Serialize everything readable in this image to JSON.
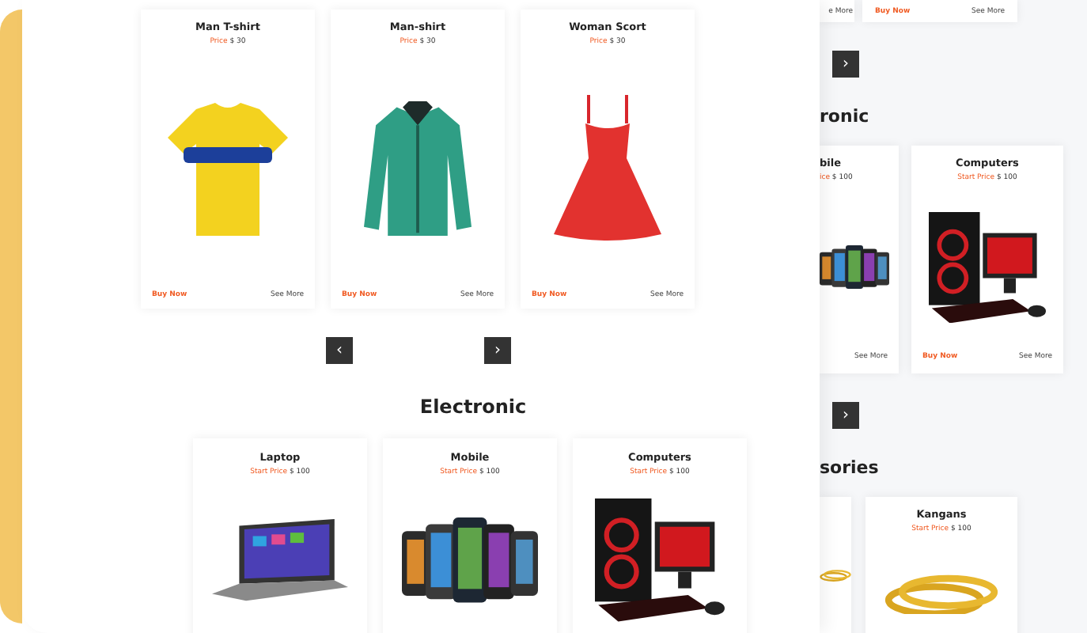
{
  "front": {
    "products": [
      {
        "name": "Man T-shirt",
        "price_label": "Price",
        "price": "$ 30",
        "kind": "tshirt",
        "buy": "Buy Now",
        "more": "See More"
      },
      {
        "name": "Man-shirt",
        "price_label": "Price",
        "price": "$ 30",
        "kind": "shirt",
        "buy": "Buy Now",
        "more": "See More"
      },
      {
        "name": "Woman Scort",
        "price_label": "Price",
        "price": "$ 30",
        "kind": "dress",
        "buy": "Buy Now",
        "more": "See More"
      }
    ],
    "prev": "‹",
    "next": "›",
    "section": {
      "title": "Electronic",
      "products": [
        {
          "name": "Laptop",
          "price_label": "Start Price",
          "price": "$ 100",
          "kind": "laptop"
        },
        {
          "name": "Mobile",
          "price_label": "Start Price",
          "price": "$ 100",
          "kind": "phones"
        },
        {
          "name": "Computers",
          "price_label": "Start Price",
          "price": "$ 100",
          "kind": "computer"
        }
      ]
    }
  },
  "back": {
    "top_cards": [
      {
        "more": "e More"
      },
      {
        "buy": "Buy Now",
        "more": "See More"
      }
    ],
    "next_1": "›",
    "title_1": "ronic",
    "cards_1": [
      {
        "name": "bile",
        "price_label": "ice",
        "price": "$ 100",
        "kind": "phones",
        "more": "See More"
      },
      {
        "name": "Computers",
        "price_label": "Start Price",
        "price": "$ 100",
        "kind": "computer",
        "buy": "Buy Now",
        "more": "See More"
      }
    ],
    "next_2": "›",
    "title_2": "sories",
    "cards_2": [
      {
        "kind": "bangles"
      },
      {
        "name": "Kangans",
        "price_label": "Start Price",
        "price": "$ 100",
        "kind": "bangles"
      }
    ]
  }
}
